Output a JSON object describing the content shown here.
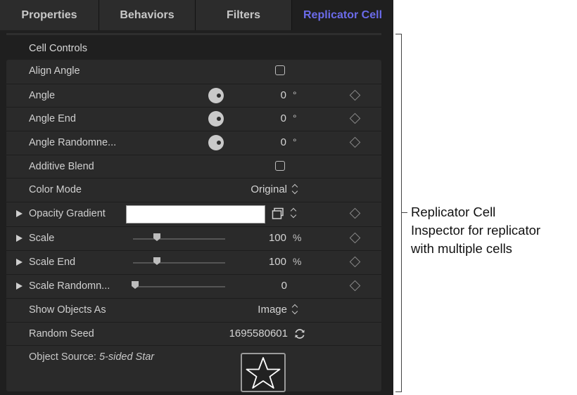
{
  "tabs": [
    {
      "label": "Properties",
      "active": false
    },
    {
      "label": "Behaviors",
      "active": false
    },
    {
      "label": "Filters",
      "active": false
    },
    {
      "label": "Replicator Cell",
      "active": true
    }
  ],
  "colors": {
    "active_tab": "#6b6bea",
    "panel_bg": "#1f1f1f",
    "row_bg": "#2a2a2a"
  },
  "group_header": "Cell Controls",
  "rows": {
    "align_angle": {
      "label": "Align Angle",
      "checked": false
    },
    "angle": {
      "label": "Angle",
      "value": "0",
      "unit": "°"
    },
    "angle_end": {
      "label": "Angle End",
      "value": "0",
      "unit": "°"
    },
    "angle_randomness": {
      "label": "Angle Randomne...",
      "value": "0",
      "unit": "°"
    },
    "additive_blend": {
      "label": "Additive Blend",
      "checked": false
    },
    "color_mode": {
      "label": "Color Mode",
      "value": "Original"
    },
    "opacity_gradient": {
      "label": "Opacity Gradient"
    },
    "scale": {
      "label": "Scale",
      "value": "100",
      "unit": "%"
    },
    "scale_end": {
      "label": "Scale End",
      "value": "100",
      "unit": "%"
    },
    "scale_randomness": {
      "label": "Scale Randomn...",
      "value": "0"
    },
    "show_objects_as": {
      "label": "Show Objects As",
      "value": "Image"
    },
    "random_seed": {
      "label": "Random Seed",
      "value": "1695580601"
    },
    "object_source": {
      "label": "Object Source:",
      "value": "5-sided Star",
      "icon": "star-icon"
    }
  },
  "annotation": {
    "lines": [
      "Replicator Cell",
      "Inspector for replicator",
      "with multiple cells"
    ]
  }
}
